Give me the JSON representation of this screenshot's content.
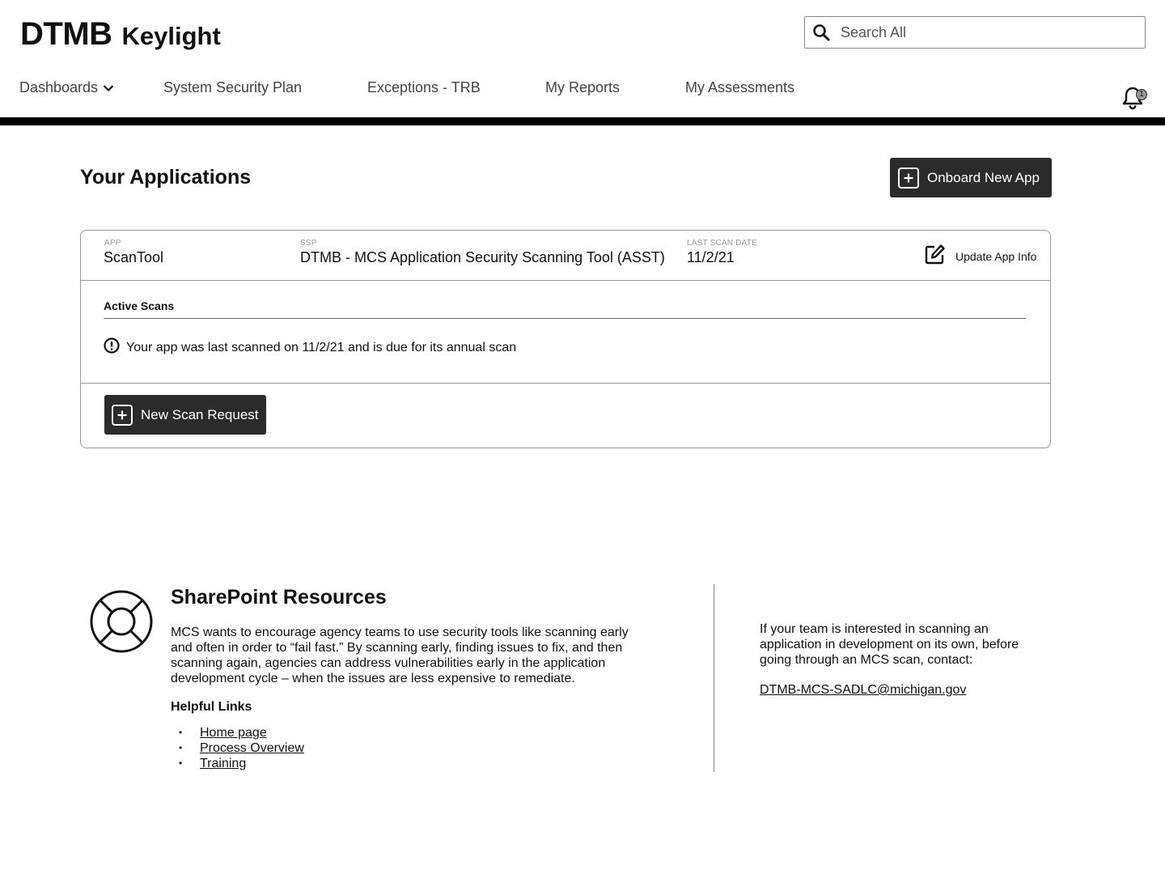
{
  "header": {
    "brand_main": "DTMB",
    "brand_sub": "Keylight",
    "search_placeholder": "Search All"
  },
  "nav": {
    "items": [
      {
        "label": "Dashboards",
        "has_dropdown": true
      },
      {
        "label": "System Security Plan"
      },
      {
        "label": "Exceptions - TRB"
      },
      {
        "label": "My Reports"
      },
      {
        "label": "My Assessments"
      }
    ],
    "notifications_count": "1"
  },
  "applications": {
    "title": "Your Applications",
    "onboard_label": "Onboard New App",
    "card": {
      "app_label": "APP",
      "app_value": "ScanTool",
      "ssp_label": "SSP",
      "ssp_value": "DTMB - MCS Application Security Scanning Tool (ASST)",
      "scan_date_label": "LAST SCAN DATE",
      "scan_date_value": "11/2/21",
      "update_label": "Update App Info",
      "active_scans_title": "Active Scans",
      "scan_message": "Your app was last scanned on 11/2/21 and is due for its annual scan",
      "new_scan_label": "New Scan Request"
    }
  },
  "resources": {
    "title": "SharePoint Resources",
    "body": "MCS wants to encourage agency teams to use security tools like scanning early and often in order to “fail fast.” By scanning early, finding issues to fix, and then scanning again, agencies can address vulnerabilities early in the application development cycle – when the issues are less expensive to remediate.",
    "links_title": "Helpful Links",
    "links": [
      "Home page",
      "Process Overview",
      "Training"
    ],
    "contact_text": "If your team is interested in scanning an application in development on its own, before going through an MCS scan, contact:",
    "contact_email": "DTMB-MCS-SADLC@michigan.gov"
  },
  "icons": {
    "search": "search-icon",
    "chevron": "chevron-down-icon",
    "bell": "bell-icon",
    "plus": "plus-square-icon",
    "edit": "edit-icon",
    "alert": "alert-circle-icon",
    "lifebuoy": "lifebuoy-icon"
  },
  "colors": {
    "button_bg": "#2b2b2b",
    "divider": "#000000"
  }
}
